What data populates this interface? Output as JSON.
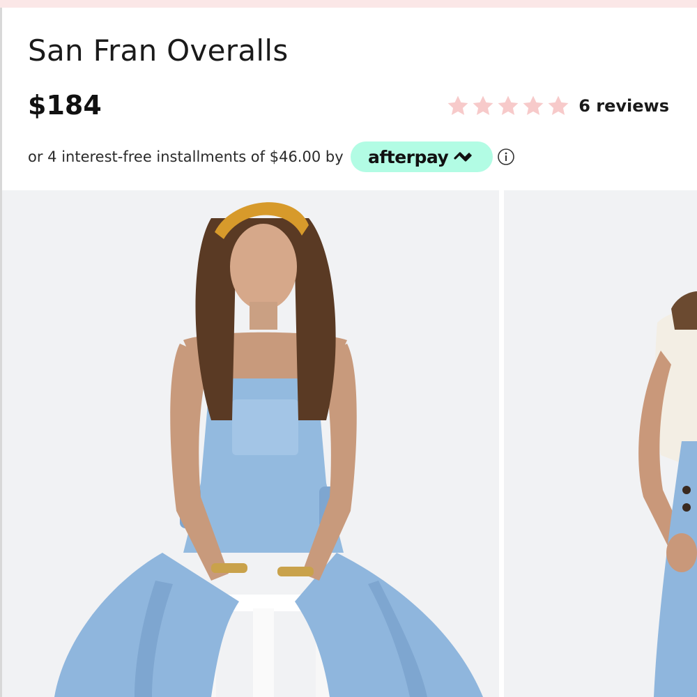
{
  "product": {
    "title": "San Fran Overalls",
    "price": "$184",
    "rating": {
      "stars": 5,
      "filled": 0,
      "reviews_label": "6 reviews"
    },
    "installments": {
      "text": "or 4 interest-free installments of $46.00 by",
      "provider": "afterpay"
    }
  },
  "gallery": {
    "images": [
      {
        "alt": "product-photo-model-seated"
      },
      {
        "alt": "product-photo-model-standing"
      }
    ]
  },
  "colors": {
    "star": "#f7caca",
    "afterpay_bg": "#b2fce4",
    "top_strip": "#fbe7e7",
    "photo_bg": "#f1f2f4",
    "denim": "#8fb6dd"
  },
  "icons": [
    "star-icon",
    "afterpay-logo-icon",
    "info-icon"
  ]
}
